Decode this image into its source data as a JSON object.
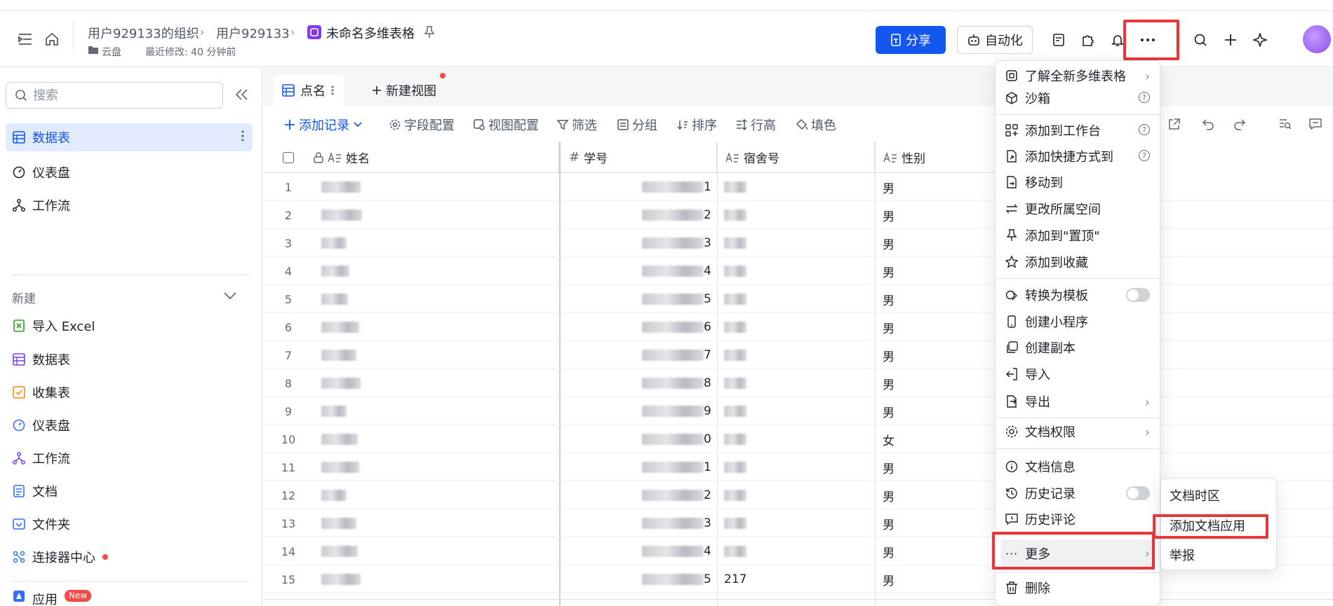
{
  "header": {
    "breadcrumb": [
      "用户929133的组织",
      "用户929133",
      "未命名多维表格"
    ],
    "location": "云盘",
    "last_modified": "最近修改: 40 分钟前",
    "share_label": "分享",
    "automation_label": "自动化",
    "accent": "#1456f0"
  },
  "sidebar": {
    "search_placeholder": "搜索",
    "nav": [
      {
        "label": "数据表",
        "icon": "table-icon"
      },
      {
        "label": "仪表盘",
        "icon": "dashboard-icon"
      },
      {
        "label": "工作流",
        "icon": "workflow-icon"
      }
    ],
    "new_section_label": "新建",
    "new_items": [
      {
        "label": "导入 Excel",
        "icon": "excel-icon"
      },
      {
        "label": "数据表",
        "icon": "table-icon"
      },
      {
        "label": "收集表",
        "icon": "form-icon"
      },
      {
        "label": "仪表盘",
        "icon": "dashboard-icon"
      },
      {
        "label": "工作流",
        "icon": "workflow-icon"
      },
      {
        "label": "文档",
        "icon": "doc-icon"
      },
      {
        "label": "文件夹",
        "icon": "folder-icon"
      },
      {
        "label": "连接器中心",
        "icon": "connector-icon"
      },
      {
        "label": "应用",
        "icon": "app-icon",
        "badge": "New"
      }
    ]
  },
  "view_tabs": {
    "active": "点名",
    "new_view": "新建视图"
  },
  "toolbar": {
    "add_record": "添加记录",
    "field_config": "字段配置",
    "view_config": "视图配置",
    "filter": "筛选",
    "group": "分组",
    "sort": "排序",
    "row_height": "行高",
    "fill_color": "填色"
  },
  "grid": {
    "columns": [
      "姓名",
      "学号",
      "宿舍号",
      "性别"
    ],
    "rows": [
      {
        "n": "1",
        "id_tail": "1",
        "dorm": "",
        "gender": "男"
      },
      {
        "n": "2",
        "id_tail": "2",
        "dorm": "",
        "gender": "男"
      },
      {
        "n": "3",
        "id_tail": "3",
        "dorm": "",
        "gender": "男"
      },
      {
        "n": "4",
        "id_tail": "4",
        "dorm": "",
        "gender": "男"
      },
      {
        "n": "5",
        "id_tail": "5",
        "dorm": "",
        "gender": "男"
      },
      {
        "n": "6",
        "id_tail": "6",
        "dorm": "",
        "gender": "男"
      },
      {
        "n": "7",
        "id_tail": "7",
        "dorm": "",
        "gender": "男"
      },
      {
        "n": "8",
        "id_tail": "8",
        "dorm": "",
        "gender": "男"
      },
      {
        "n": "9",
        "id_tail": "9",
        "dorm": "",
        "gender": "男"
      },
      {
        "n": "10",
        "id_tail": "0",
        "dorm": "",
        "gender": "女"
      },
      {
        "n": "11",
        "id_tail": "1",
        "dorm": "",
        "gender": "男"
      },
      {
        "n": "12",
        "id_tail": "2",
        "dorm": "",
        "gender": "男"
      },
      {
        "n": "13",
        "id_tail": "3",
        "dorm": "",
        "gender": "男"
      },
      {
        "n": "14",
        "id_tail": "4",
        "dorm": "",
        "gender": "男"
      },
      {
        "n": "15",
        "id_tail": "5",
        "dorm": "217",
        "gender": "男"
      }
    ]
  },
  "menu": {
    "learn": "了解全新多维表格",
    "sandbox": "沙箱",
    "add_workspace": "添加到工作台",
    "add_shortcut": "添加快捷方式到",
    "move_to": "移动到",
    "change_space": "更改所属空间",
    "pin": "添加到\"置顶\"",
    "favorite": "添加到收藏",
    "convert_template": "转换为模板",
    "create_miniapp": "创建小程序",
    "create_copy": "创建副本",
    "import": "导入",
    "export": "导出",
    "permissions": "文档权限",
    "doc_info": "文档信息",
    "history": "历史记录",
    "history_comments": "历史评论",
    "more": "更多",
    "delete": "删除"
  },
  "submenu": {
    "timezone": "文档时区",
    "add_app": "添加文档应用",
    "report": "举报"
  },
  "highlight_color": "#e8373b"
}
